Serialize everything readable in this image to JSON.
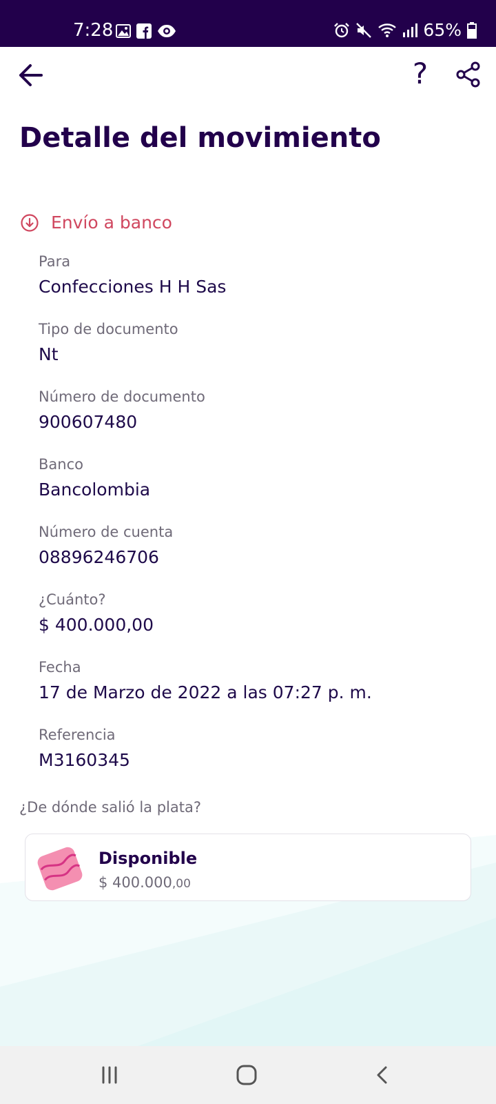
{
  "status_bar": {
    "time": "7:28",
    "battery": "65%",
    "left_icons": [
      "gallery-icon",
      "facebook-icon",
      "eye-icon"
    ],
    "right_icons": [
      "alarm-icon",
      "mute-icon",
      "wifi-icon",
      "signal-icon",
      "battery-icon"
    ]
  },
  "header": {
    "title": "Detalle del movimiento",
    "help_label": "?"
  },
  "movement": {
    "type_label": "Envío a banco",
    "fields": [
      {
        "label": "Para",
        "value": "Confecciones H H Sas"
      },
      {
        "label": "Tipo de documento",
        "value": "Nt"
      },
      {
        "label": "Número de documento",
        "value": "900607480"
      },
      {
        "label": "Banco",
        "value": "Bancolombia"
      },
      {
        "label": "Número de cuenta",
        "value": "08896246706"
      },
      {
        "label": "¿Cuánto?",
        "value": "$ 400.000,00"
      },
      {
        "label": "Fecha",
        "value": "17 de Marzo de 2022 a las 07:27 p. m."
      },
      {
        "label": "Referencia",
        "value": "M3160345"
      }
    ]
  },
  "source": {
    "question": "¿De dónde salió la plata?",
    "name": "Disponible",
    "amount_main": "$ 400.000",
    "amount_cents": ",00"
  },
  "colors": {
    "status_bar": "#22004b",
    "title": "#22004b",
    "type_accent": "#d0475f",
    "pocket_pink": "#f48fb1"
  }
}
